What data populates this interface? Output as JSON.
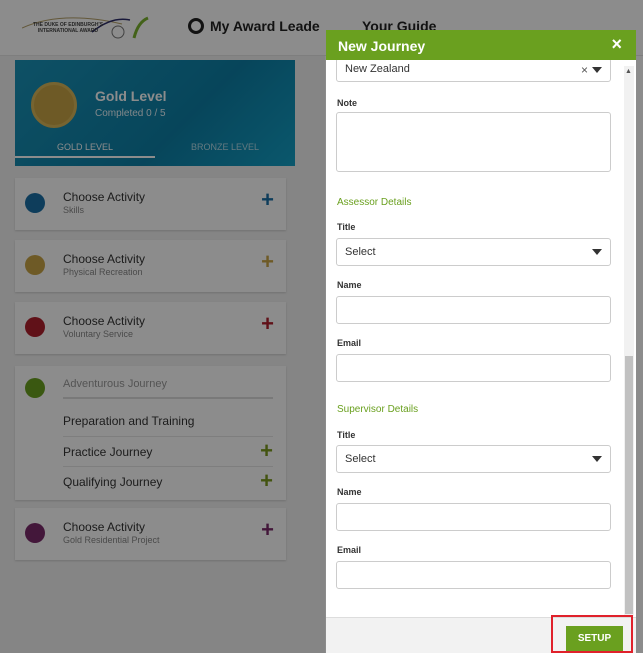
{
  "topbar": {
    "logo_text": "THE DUKE OF EDINBURGH'S INTERNATIONAL AWARD",
    "nav1": "My Award Leade",
    "nav2": "Your Guide"
  },
  "level": {
    "title": "Gold Level",
    "subtitle": "Completed 0 / 5",
    "tab_active": "GOLD LEVEL",
    "tab_other": "BRONZE LEVEL"
  },
  "activities": [
    {
      "title": "Choose Activity",
      "sub": "Skills",
      "color": "#1a6fa6",
      "plus_color": "#1a6fa6"
    },
    {
      "title": "Choose Activity",
      "sub": "Physical Recreation",
      "color": "#c9a546",
      "plus_color": "#c9a546"
    },
    {
      "title": "Choose Activity",
      "sub": "Voluntary Service",
      "color": "#b01f2d",
      "plus_color": "#b01f2d"
    }
  ],
  "adventurous": {
    "title": "Adventurous Journey",
    "color": "#6aa01f",
    "rows": [
      "Preparation and Training",
      "Practice Journey",
      "Qualifying Journey"
    ]
  },
  "residential": {
    "title": "Choose Activity",
    "sub": "Gold Residential Project",
    "color": "#7a2a6a",
    "plus_color": "#7a2a6a"
  },
  "modal": {
    "title": "New Journey",
    "close": "×",
    "country_value": "New Zealand",
    "note_label": "Note",
    "assessor_section": "Assessor Details",
    "supervisor_section": "Supervisor Details",
    "title_label": "Title",
    "name_label": "Name",
    "email_label": "Email",
    "select_placeholder": "Select",
    "setup_button": "SETUP"
  }
}
